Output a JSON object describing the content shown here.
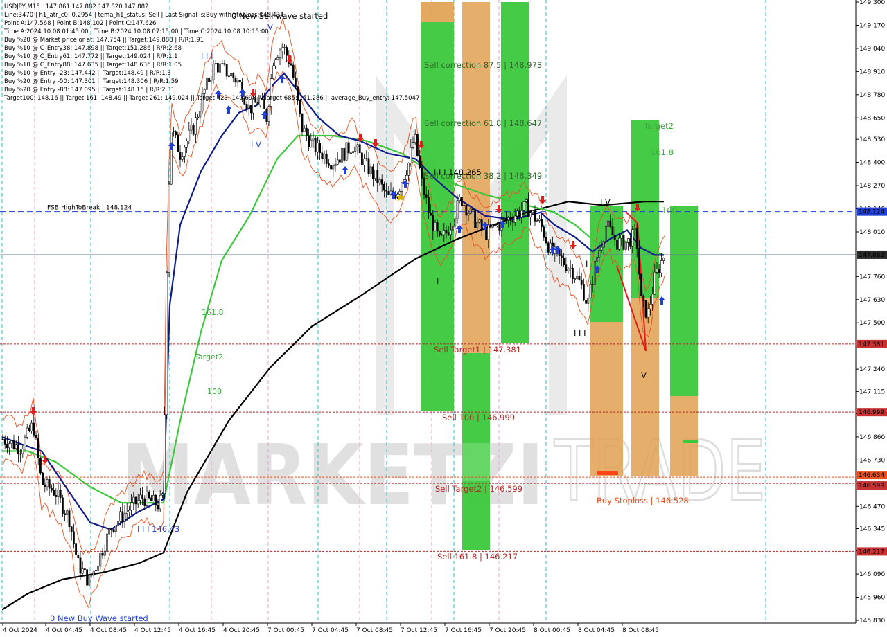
{
  "info_panel": {
    "lines": [
      "USDJPY,M15   147.861 147.882 147.820 147.882",
      "Line:3470 | h1_atr_c0: 0.2954 | tema_h1_status: Sell | Last Signal is:Buy with stoploss:145.434",
      "Point A:147.568 | Point B:148.102 | Point C:147.626",
      "Time A:2024.10.08 01:45:00 | Time B:2024.10.08 07:15:00 | Time C:2024.10.08 10:15:00",
      "Buy %20 @ Market price or at: 147.754 || Target:149.888 | R/R:1.91",
      "Buy %10 @ C_Entry38: 147.898 || Target:151.286 | R/R:2.68",
      "Buy %10 @ C_Entry61: 147.772 || Target:149.024 | R/R:1.1",
      "Buy %10 @ C_Entry88: 147.635 || Target:148.636 | R/R:1.05",
      "Buy %10 @ Entry -23: 147.442 || Target:148.49 | R/R:1.3",
      "Buy %20 @ Entry -50: 147.301 || Target:148.306 | R/R:1.59",
      "Buy %20 @ Entry -88: 147.095 || Target:148.16 | R/R:2.31",
      "Target100: 148.16 || Target 161: 148.49 || Target 261: 149.024 || Target 423: 149.698 || Target 685: 151.286 || average_Buy_entry: 147.5047"
    ]
  },
  "chart_data": {
    "type": "candlestick",
    "symbol": "USDJPY",
    "timeframe": "M15",
    "ohlc_current": {
      "open": 147.861,
      "high": 147.882,
      "low": 147.82,
      "close": 147.882
    },
    "ylim": [
      145.83,
      149.3
    ],
    "y_ticks": [
      "149.300",
      "149.170",
      "149.040",
      "148.910",
      "148.780",
      "148.650",
      "148.530",
      "148.400",
      "148.270",
      "148.140",
      "148.010",
      "147.880",
      "147.760",
      "147.630",
      "147.500",
      "147.370",
      "147.240",
      "147.115",
      "146.990",
      "146.860",
      "146.730",
      "146.600",
      "146.470",
      "146.345",
      "146.220",
      "146.090",
      "145.960",
      "145.830"
    ],
    "x_ticks": [
      "4 Oct 2024",
      "4 Oct 04:45",
      "4 Oct 08:45",
      "4 Oct 12:45",
      "4 Oct 16:45",
      "4 Oct 20:45",
      "7 Oct 00:45",
      "7 Oct 04:45",
      "7 Oct 08:45",
      "7 Oct 12:45",
      "7 Oct 16:45",
      "7 Oct 20:45",
      "8 Oct 00:45",
      "8 Oct 04:45",
      "8 Oct 08:45"
    ],
    "price_badges": [
      {
        "label": "148.124",
        "value": 148.124,
        "color": "#1f3fd6"
      },
      {
        "label": "147.882",
        "value": 147.882,
        "color": "#2a2a2a"
      },
      {
        "label": "147.381",
        "value": 147.381,
        "color": "#c83232"
      },
      {
        "label": "146.999",
        "value": 146.999,
        "color": "#c83232"
      },
      {
        "label": "146.634",
        "value": 146.634,
        "color": "#e8501e"
      },
      {
        "label": "146.599",
        "value": 146.599,
        "color": "#c83232"
      },
      {
        "label": "146.217",
        "value": 146.217,
        "color": "#c83232"
      }
    ],
    "levels": [
      {
        "value": 148.124,
        "label": "FSB-HighToBreak | 148.124",
        "color": "#1f3fd6",
        "style": "dashed"
      },
      {
        "value": 147.882,
        "label": "",
        "color": "#6a7a90",
        "style": "solid"
      },
      {
        "value": 147.381,
        "label": "",
        "color": "#b42828",
        "style": "dashed"
      },
      {
        "value": 146.999,
        "label": "",
        "color": "#b42828",
        "style": "dashed"
      },
      {
        "value": 146.634,
        "label": "",
        "color": "#e8501e",
        "style": "dashed"
      },
      {
        "value": 146.599,
        "label": "",
        "color": "#b42828",
        "style": "dashed"
      },
      {
        "value": 146.217,
        "label": "",
        "color": "#b42828",
        "style": "dashed"
      }
    ],
    "zone_labels": [
      {
        "text": "Sell correction 87.5 | 148.973",
        "color": "#2f6a2f"
      },
      {
        "text": "Sell correction 61.8 | 148.647",
        "color": "#2f6a2f"
      },
      {
        "text": "Sell correction 38.2 | 148.349",
        "color": "#2f6a2f"
      },
      {
        "text": "Sell Target1 | 147.381",
        "color": "#b42828"
      },
      {
        "text": "Sell 100 | 146.999",
        "color": "#b42828"
      },
      {
        "text": "Sell Target2 | 146.599",
        "color": "#b42828"
      },
      {
        "text": "Sell 161.8 | 146.217",
        "color": "#b42828"
      },
      {
        "text": "Buy Stoploss | 146.528",
        "color": "#e8501e"
      },
      {
        "text": "Target2",
        "color": "#3aa83a"
      },
      {
        "text": "161.8",
        "color": "#3aa83a"
      },
      {
        "text": "100",
        "color": "#3aa83a"
      }
    ],
    "left_fib_labels": [
      "161.8",
      "Target2",
      "100"
    ],
    "annotations": [
      {
        "text": "0 New Sell wave started",
        "color": "#000000"
      },
      {
        "text": "0 New Buy Wave started",
        "color": "#1f3fd6"
      },
      {
        "text": "I I I 146.43",
        "color": "#1f3fd6"
      },
      {
        "text": "I I I 148.265",
        "color": "#000000"
      },
      {
        "text": "I V",
        "color": "#1f3fd6"
      },
      {
        "text": "V",
        "color": "#1f3fd6"
      },
      {
        "text": "I I I",
        "color": "#1f3fd6"
      },
      {
        "text": "I V",
        "color": "#000000"
      },
      {
        "text": "V",
        "color": "#000000"
      },
      {
        "text": "I I I",
        "color": "#000000"
      },
      {
        "text": "I",
        "color": "#000000"
      },
      {
        "text": "I",
        "color": "#000000"
      }
    ],
    "colors": {
      "zone_green": "#3cc83c",
      "zone_orange": "#e0a050",
      "ma_fast": "#101c8c",
      "ma_mid": "#3cc83c",
      "ma_slow": "#000000",
      "envelope": "#e8501e",
      "buy_arrow": "#1f3fd6",
      "sell_arrow": "#e01e1e",
      "session_line": "#22c3c3"
    },
    "watermark": {
      "left": "MARKETZI",
      "right": "TRADE"
    }
  }
}
